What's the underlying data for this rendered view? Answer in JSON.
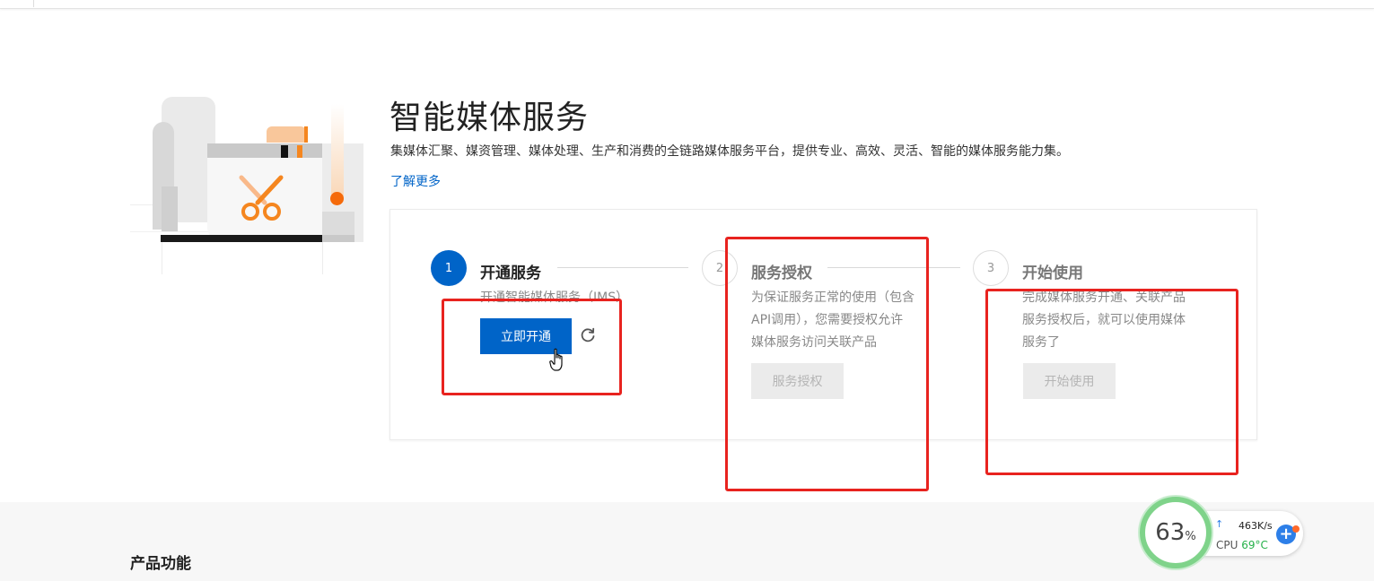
{
  "hero": {
    "title": "智能媒体服务",
    "description": "集媒体汇聚、媒资管理、媒体处理、生产和消费的全链路媒体服务平台，提供专业、高效、灵活、智能的媒体服务能力集。",
    "learn_more": "了解更多"
  },
  "steps": [
    {
      "number": "1",
      "title": "开通服务",
      "desc": "开通智能媒体服务（IMS）",
      "button": "立即开通",
      "state": "active"
    },
    {
      "number": "2",
      "title": "服务授权",
      "desc": [
        "为保证服务正常的使用（包含",
        "API调用），您需要授权允许",
        "媒体服务访问关联产品"
      ],
      "button": "服务授权",
      "state": "inactive"
    },
    {
      "number": "3",
      "title": "开始使用",
      "desc": [
        "完成媒体服务开通、关联产品",
        "服务授权后，就可以使用媒体",
        "服务了"
      ],
      "button": "开始使用",
      "state": "inactive"
    }
  ],
  "features": {
    "title": "产品功能"
  },
  "system_widget": {
    "percent": "63",
    "percent_unit": "%",
    "net_speed": "463K/s",
    "cpu_label": "CPU",
    "cpu_temp": "69°C"
  },
  "colors": {
    "primary": "#0064c8",
    "annotation_red": "#e8231f",
    "accent_orange": "#f5861f",
    "widget_green": "#26b14a"
  },
  "icons": {
    "refresh": "refresh-icon",
    "cursor": "hand-cursor-icon",
    "scissors": "scissors-icon",
    "plus": "plus-icon"
  }
}
